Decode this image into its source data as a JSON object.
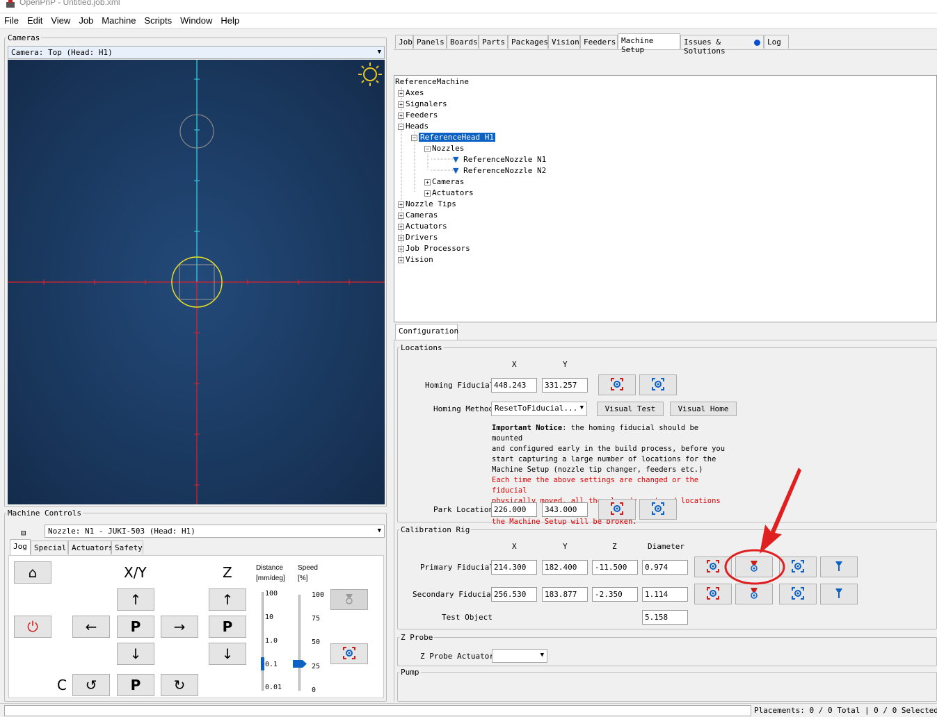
{
  "app": {
    "title": "OpenPnP - Untitled.job.xml"
  },
  "menu": [
    "File",
    "Edit",
    "View",
    "Job",
    "Machine",
    "Scripts",
    "Window",
    "Help"
  ],
  "cameras": {
    "legend": "Cameras",
    "selected": "Camera: Top (Head: H1)"
  },
  "machine_controls": {
    "legend": "Machine Controls",
    "nozzle_selected": "Nozzle: N1 - JUKI-503 (Head: H1)",
    "tabs": [
      "Jog",
      "Special",
      "Actuators",
      "Safety"
    ],
    "xy_label": "X/Y",
    "z_label": "Z",
    "c_label": "C",
    "park": "P",
    "distance_label": "Distance",
    "distance_unit": "[mm/deg]",
    "speed_label": "Speed",
    "speed_unit": "[%]",
    "distance_ticks": [
      "100",
      "10",
      "1.0",
      "0.1",
      "0.01"
    ],
    "distance_value": "0.1",
    "speed_ticks": [
      "100",
      "75",
      "50",
      "25",
      "0"
    ],
    "speed_value": 25
  },
  "main_tabs": [
    "Job",
    "Panels",
    "Boards",
    "Parts",
    "Packages",
    "Vision",
    "Feeders",
    "Machine Setup",
    "Issues & Solutions",
    "Log"
  ],
  "active_main_tab": "Machine Setup",
  "tree": {
    "root": "ReferenceMachine",
    "items": [
      "Axes",
      "Signalers",
      "Feeders",
      "Heads",
      "ReferenceHead H1",
      "Nozzles",
      "ReferenceNozzle N1",
      "ReferenceNozzle N2",
      "Cameras",
      "Actuators",
      "Nozzle Tips",
      "Cameras",
      "Actuators",
      "Drivers",
      "Job Processors",
      "Vision"
    ]
  },
  "config": {
    "tab": "Configuration",
    "locations": {
      "legend": "Locations",
      "x_header": "X",
      "y_header": "Y",
      "homing_label": "Homing Fiducial",
      "homing_x": "448.243",
      "homing_y": "331.257",
      "method_label": "Homing Method",
      "method_value": "ResetToFiducial...",
      "visual_test": "Visual Test",
      "visual_home": "Visual Home",
      "notice_bold": "Important Notice",
      "notice_lines": [
        ": the homing fiducial should be mounted",
        "and configured early in the build process, before you",
        "start capturing a large number of locations for the",
        "Machine Setup (nozzle tip changer, feeders etc.)"
      ],
      "warning_lines": [
        "Each time the above settings are changed or the fiducial",
        "physically moved, all the already captured locations in",
        "the Machine Setup will be broken."
      ],
      "park_label": "Park Location",
      "park_x": "226.000",
      "park_y": "343.000"
    },
    "calib": {
      "legend": "Calibration Rig",
      "x_header": "X",
      "y_header": "Y",
      "z_header": "Z",
      "d_header": "Diameter",
      "primary_label": "Primary Fiducial",
      "primary": [
        "214.300",
        "182.400",
        "-11.500",
        "0.974"
      ],
      "secondary_label": "Secondary Fiducial",
      "secondary": [
        "256.530",
        "183.877",
        "-2.350",
        "1.114"
      ],
      "test_label": "Test Object",
      "test_value": "5.158"
    },
    "zprobe": {
      "legend": "Z Probe",
      "actuator_label": "Z Probe Actuator"
    },
    "pump": {
      "legend": "Pump"
    }
  },
  "status": "Placements: 0 / 0 Total | 0 / 0 Selected Boa",
  "colors": {
    "camera_bg": "#1b3a63",
    "reticle_red": "#e0202a",
    "reticle_cyan": "#35d6e8",
    "reticle_yellow": "#e8e020",
    "accent": "#0b62c4",
    "highlight": "#d42828"
  }
}
